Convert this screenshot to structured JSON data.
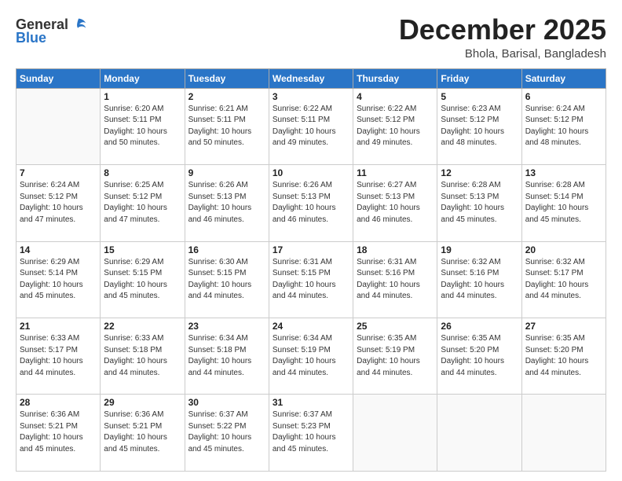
{
  "header": {
    "logo_general": "General",
    "logo_blue": "Blue",
    "month": "December 2025",
    "location": "Bhola, Barisal, Bangladesh"
  },
  "days_of_week": [
    "Sunday",
    "Monday",
    "Tuesday",
    "Wednesday",
    "Thursday",
    "Friday",
    "Saturday"
  ],
  "weeks": [
    [
      {
        "day": "",
        "info": ""
      },
      {
        "day": "1",
        "info": "Sunrise: 6:20 AM\nSunset: 5:11 PM\nDaylight: 10 hours\nand 50 minutes."
      },
      {
        "day": "2",
        "info": "Sunrise: 6:21 AM\nSunset: 5:11 PM\nDaylight: 10 hours\nand 50 minutes."
      },
      {
        "day": "3",
        "info": "Sunrise: 6:22 AM\nSunset: 5:11 PM\nDaylight: 10 hours\nand 49 minutes."
      },
      {
        "day": "4",
        "info": "Sunrise: 6:22 AM\nSunset: 5:12 PM\nDaylight: 10 hours\nand 49 minutes."
      },
      {
        "day": "5",
        "info": "Sunrise: 6:23 AM\nSunset: 5:12 PM\nDaylight: 10 hours\nand 48 minutes."
      },
      {
        "day": "6",
        "info": "Sunrise: 6:24 AM\nSunset: 5:12 PM\nDaylight: 10 hours\nand 48 minutes."
      }
    ],
    [
      {
        "day": "7",
        "info": "Sunrise: 6:24 AM\nSunset: 5:12 PM\nDaylight: 10 hours\nand 47 minutes."
      },
      {
        "day": "8",
        "info": "Sunrise: 6:25 AM\nSunset: 5:12 PM\nDaylight: 10 hours\nand 47 minutes."
      },
      {
        "day": "9",
        "info": "Sunrise: 6:26 AM\nSunset: 5:13 PM\nDaylight: 10 hours\nand 46 minutes."
      },
      {
        "day": "10",
        "info": "Sunrise: 6:26 AM\nSunset: 5:13 PM\nDaylight: 10 hours\nand 46 minutes."
      },
      {
        "day": "11",
        "info": "Sunrise: 6:27 AM\nSunset: 5:13 PM\nDaylight: 10 hours\nand 46 minutes."
      },
      {
        "day": "12",
        "info": "Sunrise: 6:28 AM\nSunset: 5:13 PM\nDaylight: 10 hours\nand 45 minutes."
      },
      {
        "day": "13",
        "info": "Sunrise: 6:28 AM\nSunset: 5:14 PM\nDaylight: 10 hours\nand 45 minutes."
      }
    ],
    [
      {
        "day": "14",
        "info": "Sunrise: 6:29 AM\nSunset: 5:14 PM\nDaylight: 10 hours\nand 45 minutes."
      },
      {
        "day": "15",
        "info": "Sunrise: 6:29 AM\nSunset: 5:15 PM\nDaylight: 10 hours\nand 45 minutes."
      },
      {
        "day": "16",
        "info": "Sunrise: 6:30 AM\nSunset: 5:15 PM\nDaylight: 10 hours\nand 44 minutes."
      },
      {
        "day": "17",
        "info": "Sunrise: 6:31 AM\nSunset: 5:15 PM\nDaylight: 10 hours\nand 44 minutes."
      },
      {
        "day": "18",
        "info": "Sunrise: 6:31 AM\nSunset: 5:16 PM\nDaylight: 10 hours\nand 44 minutes."
      },
      {
        "day": "19",
        "info": "Sunrise: 6:32 AM\nSunset: 5:16 PM\nDaylight: 10 hours\nand 44 minutes."
      },
      {
        "day": "20",
        "info": "Sunrise: 6:32 AM\nSunset: 5:17 PM\nDaylight: 10 hours\nand 44 minutes."
      }
    ],
    [
      {
        "day": "21",
        "info": "Sunrise: 6:33 AM\nSunset: 5:17 PM\nDaylight: 10 hours\nand 44 minutes."
      },
      {
        "day": "22",
        "info": "Sunrise: 6:33 AM\nSunset: 5:18 PM\nDaylight: 10 hours\nand 44 minutes."
      },
      {
        "day": "23",
        "info": "Sunrise: 6:34 AM\nSunset: 5:18 PM\nDaylight: 10 hours\nand 44 minutes."
      },
      {
        "day": "24",
        "info": "Sunrise: 6:34 AM\nSunset: 5:19 PM\nDaylight: 10 hours\nand 44 minutes."
      },
      {
        "day": "25",
        "info": "Sunrise: 6:35 AM\nSunset: 5:19 PM\nDaylight: 10 hours\nand 44 minutes."
      },
      {
        "day": "26",
        "info": "Sunrise: 6:35 AM\nSunset: 5:20 PM\nDaylight: 10 hours\nand 44 minutes."
      },
      {
        "day": "27",
        "info": "Sunrise: 6:35 AM\nSunset: 5:20 PM\nDaylight: 10 hours\nand 44 minutes."
      }
    ],
    [
      {
        "day": "28",
        "info": "Sunrise: 6:36 AM\nSunset: 5:21 PM\nDaylight: 10 hours\nand 45 minutes."
      },
      {
        "day": "29",
        "info": "Sunrise: 6:36 AM\nSunset: 5:21 PM\nDaylight: 10 hours\nand 45 minutes."
      },
      {
        "day": "30",
        "info": "Sunrise: 6:37 AM\nSunset: 5:22 PM\nDaylight: 10 hours\nand 45 minutes."
      },
      {
        "day": "31",
        "info": "Sunrise: 6:37 AM\nSunset: 5:23 PM\nDaylight: 10 hours\nand 45 minutes."
      },
      {
        "day": "",
        "info": ""
      },
      {
        "day": "",
        "info": ""
      },
      {
        "day": "",
        "info": ""
      }
    ]
  ]
}
